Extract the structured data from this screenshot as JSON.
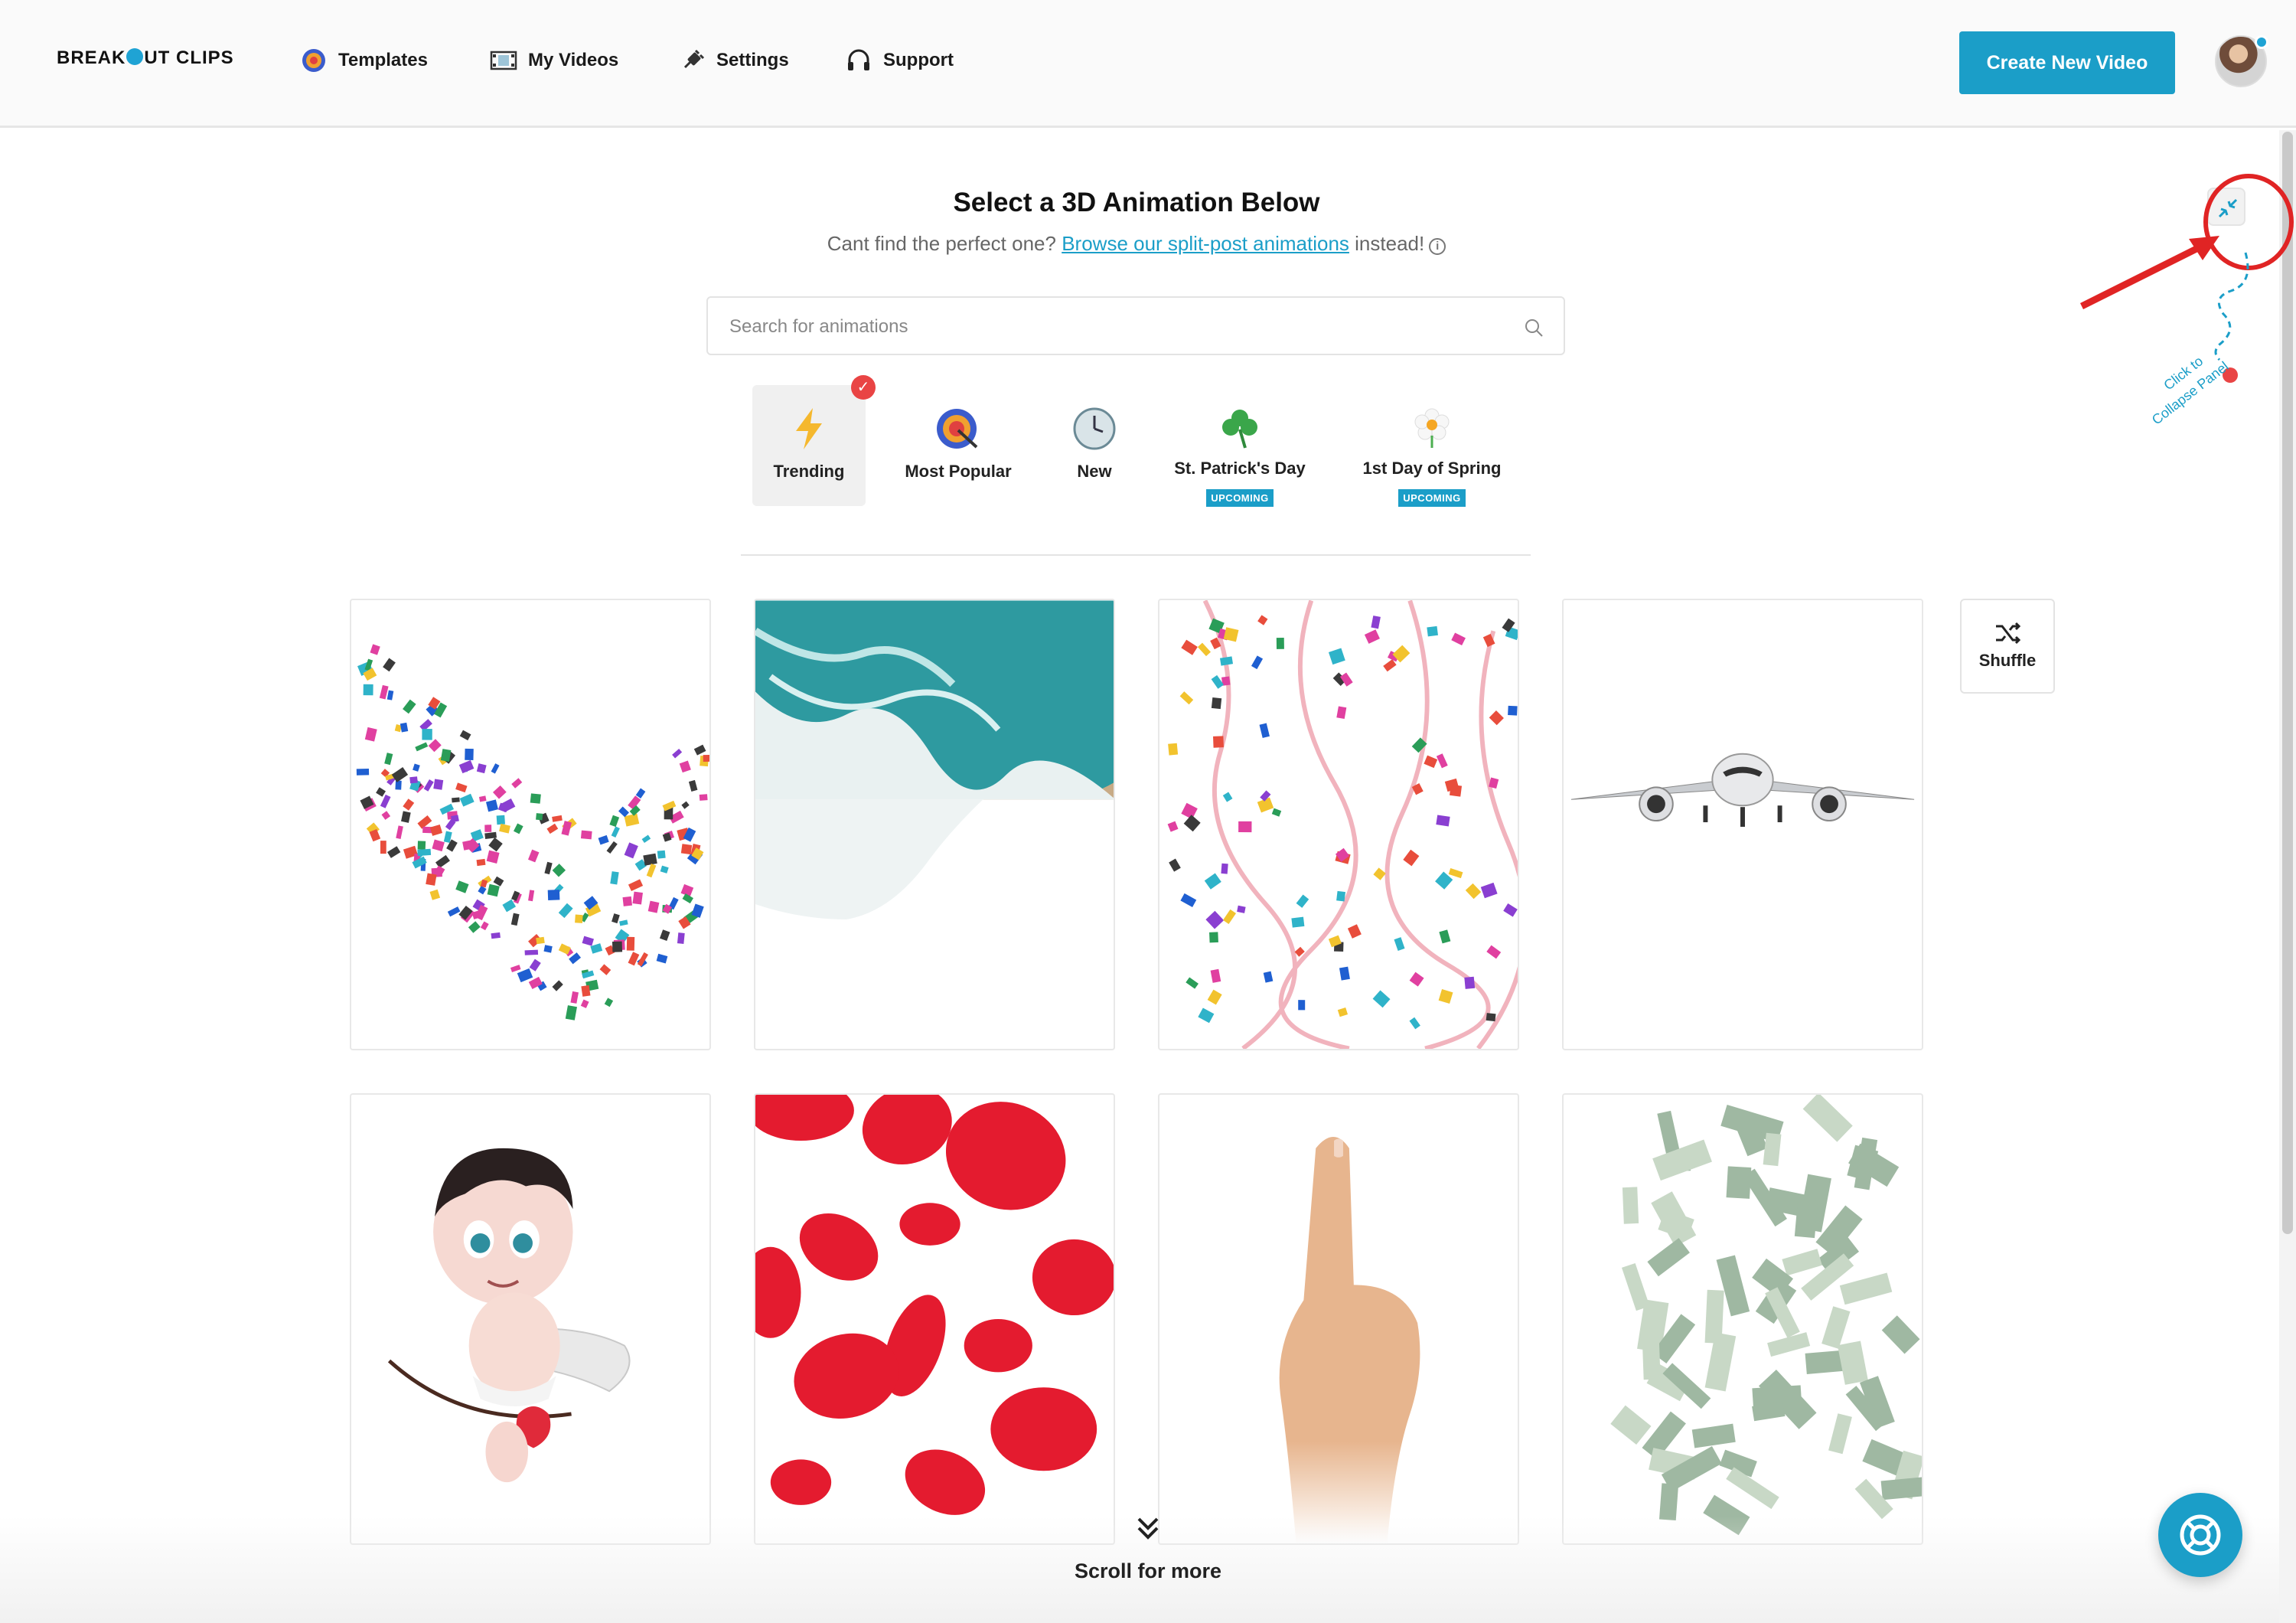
{
  "header": {
    "logo": "BREAKOUT CLIPS",
    "nav": [
      {
        "label": "Templates",
        "icon": "target-icon"
      },
      {
        "label": "My Videos",
        "icon": "film-icon"
      },
      {
        "label": "Settings",
        "icon": "plug-icon"
      },
      {
        "label": "Support",
        "icon": "headphones-icon"
      }
    ],
    "cta_label": "Create New Video"
  },
  "main": {
    "title": "Select a 3D Animation Below",
    "subtitle_prefix": "Cant find the perfect one? ",
    "subtitle_link": "Browse our split-post animations",
    "subtitle_suffix": " instead!",
    "search_placeholder": "Search for animations",
    "categories": [
      {
        "label": "Trending",
        "icon": "lightning-icon",
        "active": true,
        "badge": ""
      },
      {
        "label": "Most Popular",
        "icon": "target-icon",
        "active": false,
        "badge": ""
      },
      {
        "label": "New",
        "icon": "clock-icon",
        "active": false,
        "badge": ""
      },
      {
        "label": "St. Patrick's Day",
        "icon": "shamrock-icon",
        "active": false,
        "badge": "UPCOMING"
      },
      {
        "label": "1st Day of Spring",
        "icon": "flower-icon",
        "active": false,
        "badge": "UPCOMING"
      }
    ],
    "shuffle_label": "Shuffle",
    "cards": [
      {
        "name": "confetti-burst"
      },
      {
        "name": "ocean-waves"
      },
      {
        "name": "confetti-streamers"
      },
      {
        "name": "airplane"
      },
      {
        "name": "cupid"
      },
      {
        "name": "rose-petals"
      },
      {
        "name": "pointing-finger"
      },
      {
        "name": "money-rain"
      }
    ],
    "scroll_more": "Scroll for more"
  },
  "annotation": {
    "text_line1": "Click to",
    "text_line2": "Collapse Panel"
  },
  "colors": {
    "accent": "#1b9ec8",
    "annotation_red": "#e02424"
  }
}
